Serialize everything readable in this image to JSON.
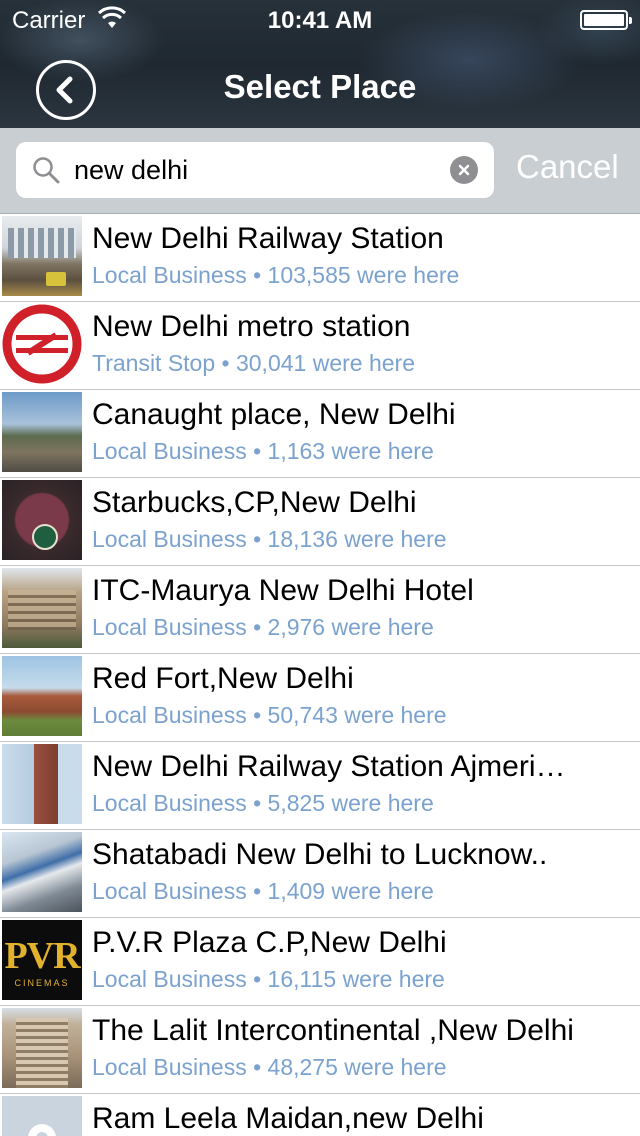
{
  "status_bar": {
    "carrier": "Carrier",
    "time": "10:41 AM",
    "wifi_icon": "wifi-icon",
    "battery_icon": "battery-full-icon"
  },
  "nav": {
    "title": "Select Place",
    "back_icon": "chevron-left-icon"
  },
  "search": {
    "value": "new delhi",
    "cancel_label": "Cancel",
    "search_icon": "search-icon",
    "clear_icon": "clear-icon"
  },
  "colors": {
    "subtitle": "#7ba2cf",
    "searchbar_bg": "#c9ced2",
    "metro_red": "#d0202a"
  },
  "places": [
    {
      "title": "New Delhi Railway Station",
      "subtitle": "Local Business • 103,585 were here",
      "thumb": "station"
    },
    {
      "title": "New Delhi metro station",
      "subtitle": "Transit Stop • 30,041 were here",
      "thumb": "metro"
    },
    {
      "title": "Canaught place, New Delhi",
      "subtitle": "Local Business • 1,163 were here",
      "thumb": "place"
    },
    {
      "title": "Starbucks,CP,New Delhi",
      "subtitle": "Local Business • 18,136 were here",
      "thumb": "starbucks"
    },
    {
      "title": "ITC-Maurya New Delhi Hotel",
      "subtitle": "Local Business • 2,976 were here",
      "thumb": "hotel"
    },
    {
      "title": "Red Fort,New Delhi",
      "subtitle": "Local Business • 50,743 were here",
      "thumb": "fort"
    },
    {
      "title": "New Delhi Railway Station Ajmeri…",
      "subtitle": "Local Business • 5,825 were here",
      "thumb": "ajmeri"
    },
    {
      "title": "Shatabadi New Delhi to Lucknow..",
      "subtitle": "Local Business • 1,409 were here",
      "thumb": "train"
    },
    {
      "title": "P.V.R Plaza C.P,New Delhi",
      "subtitle": "Local Business • 16,115 were here",
      "thumb": "pvr",
      "logo_text": "PVR",
      "logo_subtext": "CINEMAS"
    },
    {
      "title": "The Lalit Intercontinental ,New Delhi",
      "subtitle": "Local Business • 48,275 were here",
      "thumb": "lalit"
    },
    {
      "title": "Ram Leela Maidan,new Delhi",
      "subtitle": "",
      "thumb": "maidan"
    }
  ]
}
